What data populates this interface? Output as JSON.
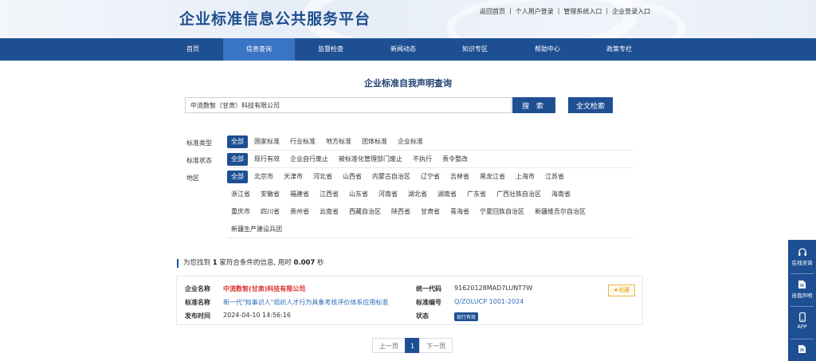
{
  "header": {
    "site_title": "企业标准信息公共服务平台",
    "links": [
      "返回首页",
      "个人用户登录",
      "管理系统入口",
      "企业登录入口"
    ]
  },
  "nav": {
    "items": [
      "首页",
      "信息查询",
      "监督检查",
      "新闻动态",
      "知识专区",
      "帮助中心",
      "政策专栏"
    ],
    "active": "信息查询"
  },
  "search": {
    "heading": "企业标准自我声明查询",
    "value": "中流数智（甘肃）科技有限公司",
    "search_label": "搜 索",
    "fulltext_label": "全文检索"
  },
  "filters": {
    "type": {
      "label": "标准类型",
      "options": [
        "全部",
        "国家标准",
        "行业标准",
        "地方标准",
        "团体标准",
        "企业标准"
      ]
    },
    "status": {
      "label": "标准状态",
      "options": [
        "全部",
        "现行有效",
        "企业自行废止",
        "被标准化管理部门废止",
        "不执行",
        "责令整改"
      ]
    },
    "region": {
      "label": "地区",
      "row1": [
        "全部",
        "北京市",
        "天津市",
        "河北省",
        "山西省",
        "内蒙古自治区",
        "辽宁省",
        "吉林省",
        "黑龙江省",
        "上海市",
        "江苏省"
      ],
      "row2": [
        "浙江省",
        "安徽省",
        "福建省",
        "江西省",
        "山东省",
        "河南省",
        "湖北省",
        "湖南省",
        "广东省",
        "广西壮族自治区",
        "海南省"
      ],
      "row3": [
        "重庆市",
        "四川省",
        "贵州省",
        "云南省",
        "西藏自治区",
        "陕西省",
        "甘肃省",
        "青海省",
        "宁夏回族自治区",
        "新疆维吾尔自治区"
      ],
      "row4": [
        "新疆生产建设兵团"
      ]
    }
  },
  "result": {
    "prefix": "为您找到",
    "count": "1",
    "middle": "家符合条件的信息, 用时",
    "time": "0.007",
    "suffix": "秒"
  },
  "card": {
    "company_label": "企业名称",
    "company": "中流数智(甘肃)科技有限公司",
    "std_name_label": "标准名称",
    "std_name": "新一代\"知事识人\"组织人才行为具象考核评价体系应用标准",
    "publish_label": "发布时间",
    "publish_time": "2024-04-10 14:56:16",
    "credit_label": "统一代码",
    "credit_code": "91620128MAD7LUNT7W",
    "std_no_label": "标准编号",
    "std_no": "Q/ZOLUCP 1001-2024",
    "status_label": "状态",
    "status": "现行有效",
    "fav_label": "收藏"
  },
  "pager": {
    "prev": "上一页",
    "current": "1",
    "next": "下一页"
  },
  "float_bar": {
    "items": [
      "在线咨询",
      "自我声明",
      "APP"
    ]
  },
  "colors": {
    "primary": "#1e4f93",
    "nav_active": "#3a74c4",
    "company_red": "#d9302c",
    "link_blue": "#2b6cb8",
    "fav_orange": "#e59c14"
  }
}
